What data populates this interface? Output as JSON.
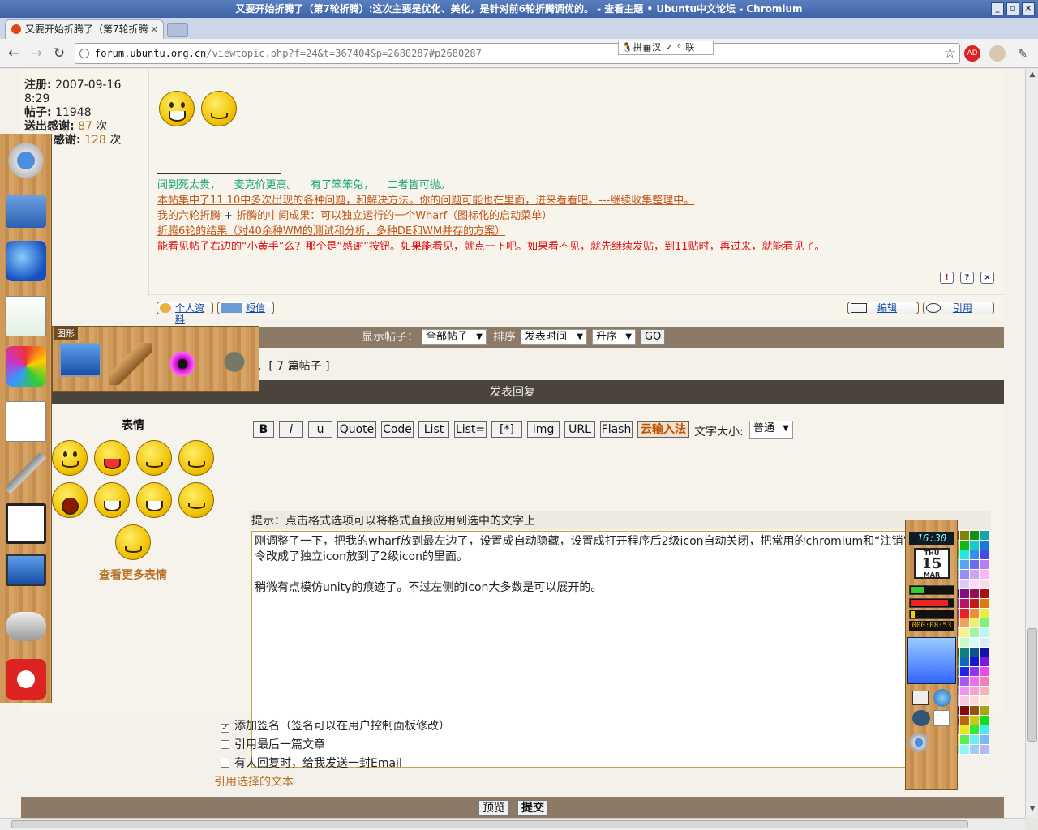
{
  "window": {
    "title": "又要开始折腾了（第7轮折腾）:这次主要是优化、美化，是针对前6轮折腾调优的。 - 查看主题 • Ubuntu中文论坛 - Chromium",
    "btn_min": "_",
    "btn_max": "▫",
    "btn_close": "×"
  },
  "tab": {
    "title": "又要开始折腾了（第7轮折腾",
    "close": "×"
  },
  "toolbar": {
    "back": "←",
    "forward": "→",
    "reload": "↻",
    "url_host": "forum.ubuntu.org.cn",
    "url_path": "/viewtopic.php?f=24&t=367404&p=2680287#p2680287",
    "star": "☆",
    "ime": "🐧拼▦汉 ✓ ⁰ 联"
  },
  "profile": {
    "reg_label": "注册:",
    "reg_value": "2007-09-16",
    "reg_time": "8:29",
    "posts_label": "帖子:",
    "posts_value": "11948",
    "thanks_sent_label": "送出感谢:",
    "thanks_sent_value": "87",
    "thanks_recv_label": "感谢:",
    "thanks_recv_value": "128",
    "unit": "次"
  },
  "signature": {
    "line1_a": "闻到死太贵，",
    "line1_b": "麦克价更高。",
    "line1_c": "有了笨笨兔，",
    "line1_d": "二者皆可抛。",
    "line2": "本帖集中了11.10中多次出现的各种问题，和解决方法。你的问题可能也在里面，进来看看吧。---继续收集整理中。",
    "line3_a": "我的六轮折腾",
    "line3_plus": "+",
    "line3_b": "折腾的中间成果：可以独立运行的一个Wharf（图标化的启动菜单）",
    "line4": "折腾6轮的结果（对40余种WM的测试和分析，多种DE和WM并存的方案）",
    "line5": "能看见帖子右边的“小黄手”么？那个是“感谢”按钮。如果能看见，就点一下吧。如果看不见，就先继续发贴，到11贴时，再过来，就能看见了。"
  },
  "post_buttons": {
    "report": "!",
    "info": "?",
    "delete": "×",
    "profile": "个人资料",
    "pm": "短信",
    "edit": "编辑",
    "quote": "引用"
  },
  "display_bar": {
    "label": "显示帖子：",
    "posts_select": "全部帖子",
    "sort_label": "排序",
    "sort_select": "发表时间",
    "order_select": "升序",
    "go": "GO"
  },
  "total_posts": "[ 7 篇帖子 ]",
  "total_prefix": ".",
  "reply": {
    "header": "发表回复",
    "smilies_title": "表情",
    "more_smilies": "查看更多表情",
    "buttons": [
      "B",
      "i",
      "u",
      "Quote",
      "Code",
      "List",
      "List=",
      "[*]",
      "Img",
      "URL",
      "Flash",
      "云输入法"
    ],
    "font_size_label": "文字大小:",
    "font_size_value": "普通",
    "tip": "提示：点击格式选项可以将格式直接应用到选中的文字上",
    "message": "刚调整了一下，把我的wharf放到最左边了，设置成自动隐藏，设置成打开程序后2级icon自动关闭，把常用的chromium和“注销”命令改成了独立icon放到了2级icon的里面。\n\n稍微有点模仿unity的痕迹了。不过左侧的icon大多数是可以展开的。",
    "opt_signature": "添加签名（签名可以在用户控制面板修改）",
    "opt_quote_last": "引用最后一篇文章",
    "opt_notify": "有人回复时，给我发送一封Email",
    "quote_selected": "引用选择的文本",
    "preview": "预览",
    "submit": "提交",
    "check": "✓"
  },
  "dock": {
    "drawer_label": "图形"
  },
  "widgets": {
    "clock": "16:30",
    "cal_dow": "THU",
    "cal_day": "15",
    "cal_month": "MAR",
    "uptime": "000:08:53",
    "cpu_fraction": 0.3,
    "mem_fraction": 0.85,
    "swap_fraction": 0.1
  },
  "colors": {
    "accent_orange": "#b8722a",
    "sig_green": "#1ba86b",
    "sig_red": "#e01010",
    "bar_brown": "#8a7a66",
    "header_dark": "#4a443c"
  }
}
